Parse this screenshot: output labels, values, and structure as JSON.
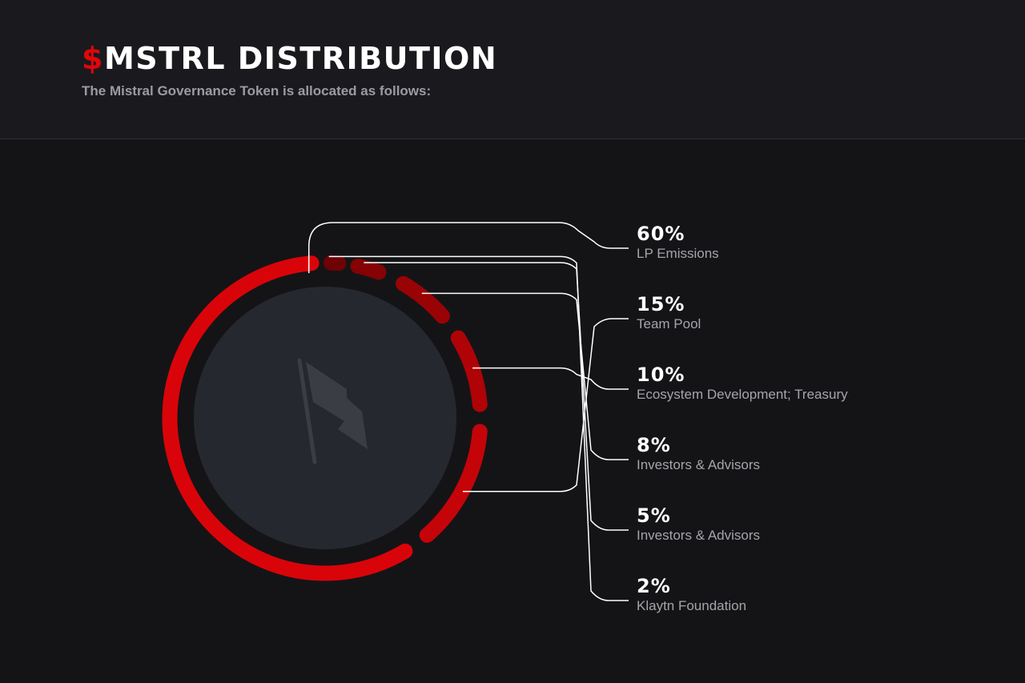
{
  "header": {
    "title_symbol": "$",
    "title_text": "MSTRL DISTRIBUTION",
    "subtitle": "The Mistral Governance Token is allocated as follows:"
  },
  "chart_data": {
    "type": "pie",
    "series": [
      {
        "value": 60,
        "value_label": "60%",
        "label": "LP Emissions",
        "color": "#d90409"
      },
      {
        "value": 15,
        "value_label": "15%",
        "label": "Team Pool",
        "color": "#c40408"
      },
      {
        "value": 10,
        "value_label": "10%",
        "label": "Ecosystem Development; Treasury",
        "color": "#b00307"
      },
      {
        "value": 8,
        "value_label": "8%",
        "label": "Investors & Advisors",
        "color": "#9a0306"
      },
      {
        "value": 5,
        "value_label": "5%",
        "label": "Investors & Advisors",
        "color": "#850205"
      },
      {
        "value": 2,
        "value_label": "2%",
        "label": "Klaytn Foundation",
        "color": "#6e0204"
      }
    ],
    "center_icon": "mistral-flag-logo-icon"
  },
  "colors": {
    "accent": "#e1060b",
    "background": "#141417",
    "header_background": "#1a1a1e",
    "center_disc": "#262830"
  }
}
